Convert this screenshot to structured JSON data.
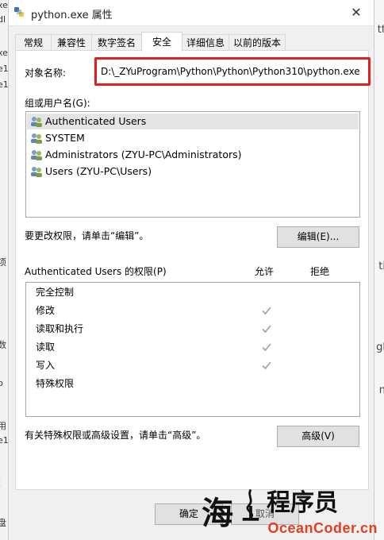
{
  "window": {
    "title": "python.exe 属性",
    "close_glyph": "✕"
  },
  "tabs": [
    {
      "label": "常规"
    },
    {
      "label": "兼容性"
    },
    {
      "label": "数字签名"
    },
    {
      "label": "安全",
      "active": true
    },
    {
      "label": "详细信息"
    },
    {
      "label": "以前的版本"
    }
  ],
  "security": {
    "object_name_label": "对象名称:",
    "object_name_value": "D:\\_ZYuProgram\\Python\\Python\\Python310\\python.exe",
    "groups_label": "组或用户名(G):",
    "users": [
      {
        "name": "Authenticated Users",
        "selected": true
      },
      {
        "name": "SYSTEM"
      },
      {
        "name": "Administrators (ZYU-PC\\Administrators)"
      },
      {
        "name": "Users (ZYU-PC\\Users)"
      }
    ],
    "edit_hint": "要更改权限，请单击“编辑”。",
    "edit_button": "编辑(E)...",
    "permissions_label": "Authenticated Users 的权限(P)",
    "allow_header": "允许",
    "deny_header": "拒绝",
    "permissions": [
      {
        "name": "完全控制",
        "allow": false
      },
      {
        "name": "修改",
        "allow": true
      },
      {
        "name": "读取和执行",
        "allow": true
      },
      {
        "name": "读取",
        "allow": true
      },
      {
        "name": "写入",
        "allow": true
      },
      {
        "name": "特殊权限",
        "allow": false
      }
    ],
    "advanced_hint": "有关特殊权限或高级设置，请单击“高级”。",
    "advanced_button": "高级(V)"
  },
  "footer": {
    "ok_button": "确定",
    "cancel_button_partial": "取消"
  },
  "watermark": {
    "chars": "海上程序员",
    "domain": "OceanCoder.cn",
    "color": "#e53e1f"
  },
  "background_fragments": {
    "left": [
      "xe",
      "dl",
      "xe",
      "e1",
      "e1",
      "项",
      "数",
      "p",
      "用",
      "e1",
      "(",
      "盘"
    ],
    "right": [
      "tt",
      "ti",
      "gl",
      "n"
    ]
  }
}
